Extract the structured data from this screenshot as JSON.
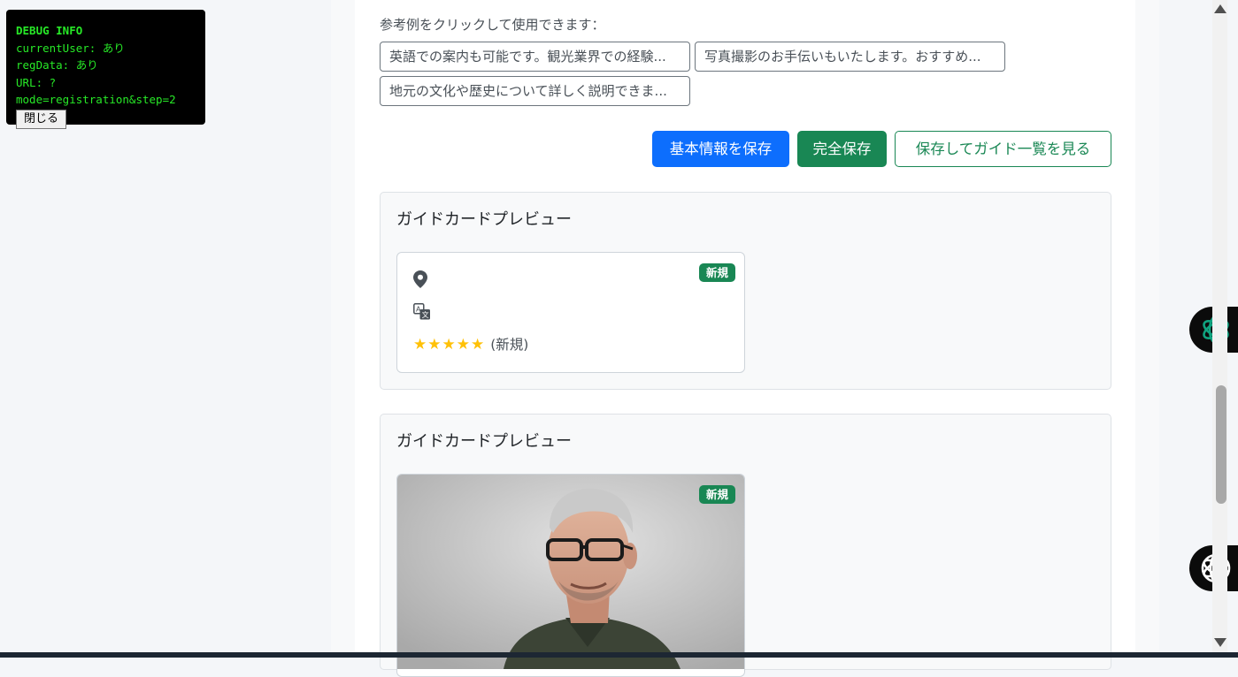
{
  "debug": {
    "title": "DEBUG INFO",
    "current_user": "currentUser: あり",
    "reg_data": "regData: あり",
    "url": "URL: ?mode=registration&step=2",
    "close_label": "閉じる"
  },
  "examples": {
    "label": "参考例をクリックして使用できます：",
    "chips": [
      "英語での案内も可能です。観光業界での経験...",
      "写真撮影のお手伝いもいたします。おすすめ...",
      "地元の文化や歴史について詳しく説明できま..."
    ]
  },
  "actions": {
    "save_basic": "基本情報を保存",
    "save_full": "完全保存",
    "save_and_view": "保存してガイド一覧を見る"
  },
  "previews": [
    {
      "title": "ガイドカードプレビュー",
      "badge": "新規",
      "stars": "★★★★★",
      "rating_text": "(新規)"
    },
    {
      "title": "ガイドカードプレビュー",
      "badge": "新規"
    }
  ],
  "icons": {
    "location": "map-marker-icon",
    "language": "translate-icon",
    "assistant_1": "openai-icon",
    "assistant_2": "perplexity-icon"
  },
  "colors": {
    "primary": "#0d6efd",
    "success": "#198754",
    "star": "#ffc107",
    "debug_text": "#27e827"
  }
}
